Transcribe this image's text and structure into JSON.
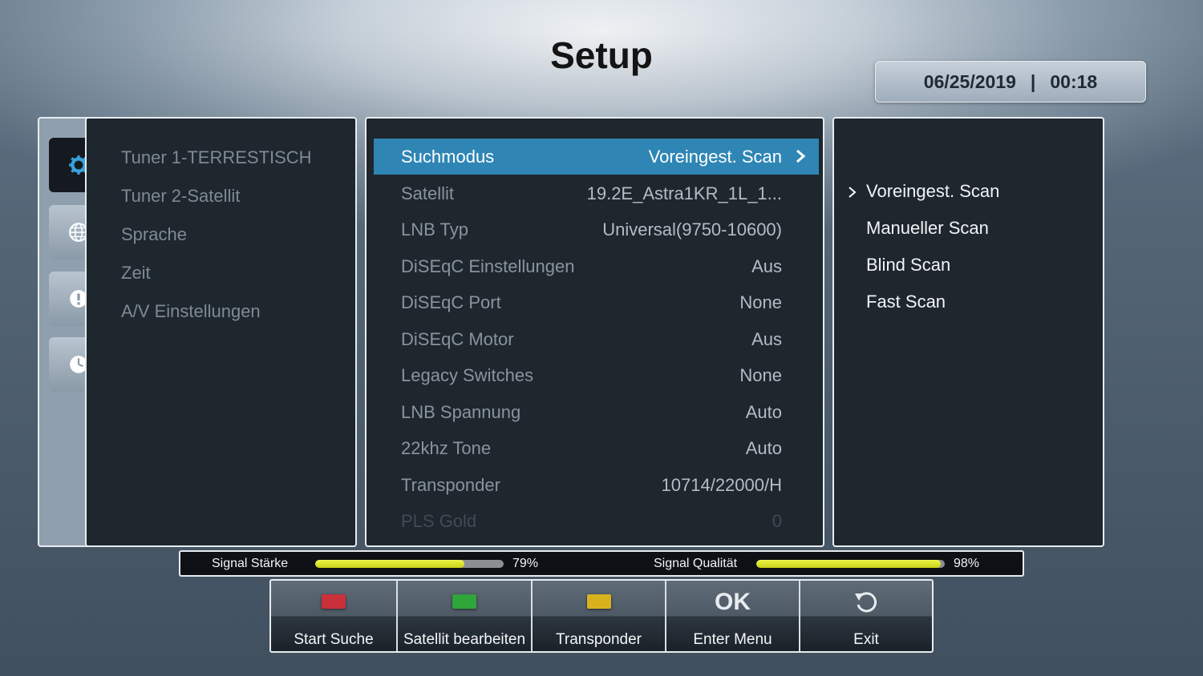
{
  "header": {
    "title": "Setup",
    "date": "06/25/2019",
    "separator": "|",
    "time": "00:18"
  },
  "sidebar": {
    "icons": [
      "gear-icon",
      "globe-icon",
      "lock-icon",
      "clock-icon"
    ]
  },
  "left_menu": {
    "items": [
      {
        "label": "Tuner 1-TERRESTISCH"
      },
      {
        "label": "Tuner 2-Satellit"
      },
      {
        "label": "Sprache"
      },
      {
        "label": "Zeit"
      },
      {
        "label": "A/V Einstellungen"
      }
    ]
  },
  "settings": {
    "rows": [
      {
        "label": "Suchmodus",
        "value": "Voreingest. Scan",
        "selected": true
      },
      {
        "label": "Satellit",
        "value": "19.2E_Astra1KR_1L_1..."
      },
      {
        "label": "LNB Typ",
        "value": "Universal(9750-10600)"
      },
      {
        "label": "DiSEqC Einstellungen",
        "value": "Aus"
      },
      {
        "label": "DiSEqC Port",
        "value": "None"
      },
      {
        "label": "DiSEqC Motor",
        "value": "Aus"
      },
      {
        "label": "Legacy Switches",
        "value": "None"
      },
      {
        "label": "LNB Spannung",
        "value": "Auto"
      },
      {
        "label": "22khz Tone",
        "value": "Auto"
      },
      {
        "label": "Transponder",
        "value": "10714/22000/H"
      },
      {
        "label": "PLS Gold",
        "value": "0",
        "dim": true
      }
    ]
  },
  "options": {
    "items": [
      {
        "label": "Voreingest. Scan",
        "current": true
      },
      {
        "label": "Manueller Scan"
      },
      {
        "label": "Blind Scan"
      },
      {
        "label": "Fast Scan"
      }
    ]
  },
  "signal": {
    "strength_label": "Signal Stärke",
    "strength_value": 79,
    "strength_text": "79%",
    "quality_label": "Signal Qualität",
    "quality_value": 98,
    "quality_text": "98%"
  },
  "buttons": [
    {
      "caption": "Start Suche",
      "key_color": "#c8303a"
    },
    {
      "caption": "Satellit bearbeiten",
      "key_color": "#2fa53a"
    },
    {
      "caption": "Transponder",
      "key_color": "#d8b21e"
    },
    {
      "caption": "Enter Menu",
      "key_text": "OK"
    },
    {
      "caption": "Exit"
    }
  ],
  "colors": {
    "selection": "#2f86b5",
    "signal_fill": "#d6de22",
    "panel": "#1e262e"
  }
}
